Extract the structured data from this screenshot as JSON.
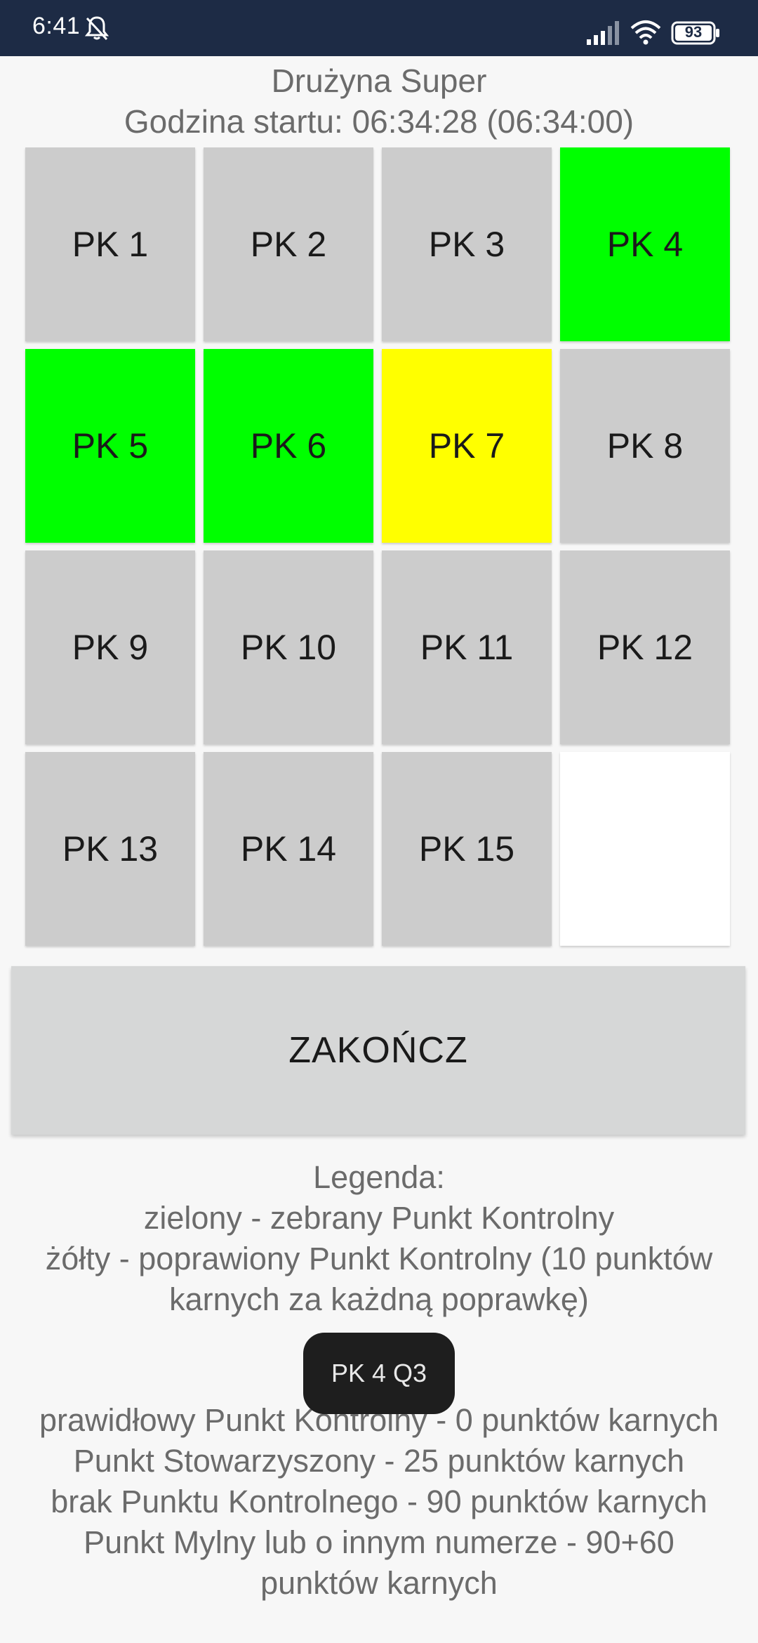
{
  "status_bar": {
    "time": "6:41",
    "battery": "93",
    "icons": [
      "bell-muted-icon",
      "signal-icon",
      "wifi-icon",
      "battery-icon"
    ]
  },
  "header": {
    "team": "Drużyna Super",
    "start_time": "Godzina startu: 06:34:28 (06:34:00)"
  },
  "colors": {
    "collected": "#00ff00",
    "corrected": "#ffff00",
    "default": "#cccccc",
    "empty": "#ffffff"
  },
  "checkpoints": [
    {
      "label": "PK 1",
      "state": "default"
    },
    {
      "label": "PK 2",
      "state": "default"
    },
    {
      "label": "PK 3",
      "state": "default"
    },
    {
      "label": "PK 4",
      "state": "collected"
    },
    {
      "label": "PK 5",
      "state": "collected"
    },
    {
      "label": "PK 6",
      "state": "collected"
    },
    {
      "label": "PK 7",
      "state": "corrected"
    },
    {
      "label": "PK 8",
      "state": "default"
    },
    {
      "label": "PK 9",
      "state": "default"
    },
    {
      "label": "PK 10",
      "state": "default"
    },
    {
      "label": "PK 11",
      "state": "default"
    },
    {
      "label": "PK 12",
      "state": "default"
    },
    {
      "label": "PK 13",
      "state": "default"
    },
    {
      "label": "PK 14",
      "state": "default"
    },
    {
      "label": "PK 15",
      "state": "default"
    },
    {
      "label": "",
      "state": "empty"
    }
  ],
  "finish_button": "ZAKOŃCZ",
  "legend": {
    "title": "Legenda:",
    "green": "zielony - zebrany Punkt Kontrolny",
    "yellow_1": "żółty - poprawiony Punkt Kontrolny (10 punktów",
    "yellow_2": "karnych za każdną poprawkę)"
  },
  "penalties": {
    "line_1": "prawidłowy Punkt Kontrolny - 0 punktów karnych",
    "line_2": "Punkt Stowarzyszony - 25 punktów karnych",
    "line_3": "brak Punktu Kontrolnego - 90 punktów karnych",
    "line_4": "Punkt Mylny lub o innym numerze - 90+60",
    "line_5": "punktów karnych"
  },
  "toast": "PK 4 Q3"
}
